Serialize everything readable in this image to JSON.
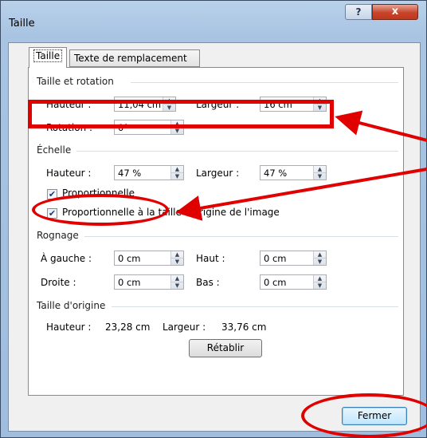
{
  "window": {
    "title": "Taille",
    "help_label": "?",
    "close_label": "x"
  },
  "tabs": [
    {
      "label": "Taille",
      "active": true
    },
    {
      "label": "Texte de remplacement",
      "active": false
    }
  ],
  "size_rotation": {
    "title": "Taille et rotation",
    "height_label": "Hauteur :",
    "height_value": "11,04 cm",
    "width_label": "Largeur :",
    "width_value": "16 cm",
    "rotation_label": "Rotation :",
    "rotation_value": "0°"
  },
  "scale": {
    "title": "Échelle",
    "height_label": "Hauteur :",
    "height_value": "47 %",
    "width_label": "Largeur :",
    "width_value": "47 %",
    "proportional_label": "Proportionnelle",
    "proportional_checked": true,
    "original_proportional_label": "Proportionnelle à la taille d'origine de l'image",
    "original_proportional_checked": true
  },
  "crop": {
    "title": "Rognage",
    "left_label": "À gauche :",
    "left_value": "0 cm",
    "top_label": "Haut :",
    "top_value": "0 cm",
    "right_label": "Droite :",
    "right_value": "0 cm",
    "bottom_label": "Bas :",
    "bottom_value": "0 cm"
  },
  "original_size": {
    "title": "Taille d'origine",
    "height_label": "Hauteur :",
    "height_value": "23,28 cm",
    "width_label": "Largeur :",
    "width_value": "33,76 cm",
    "reset_label": "Rétablir"
  },
  "footer": {
    "close_label": "Fermer"
  },
  "annotation_color": "#e00000"
}
